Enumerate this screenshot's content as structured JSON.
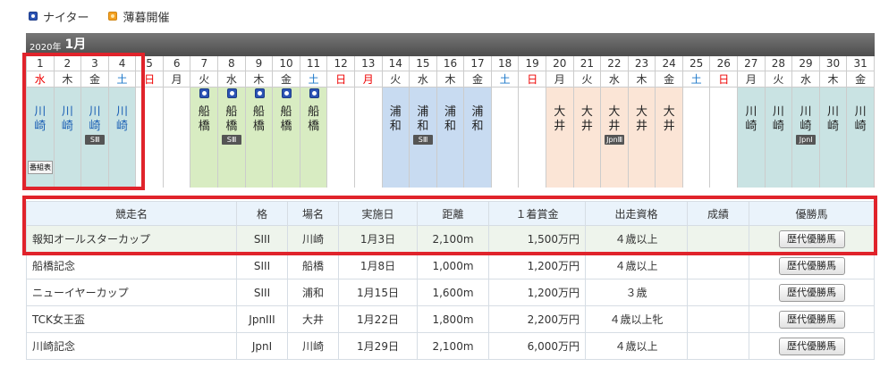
{
  "legend": {
    "night": "ナイター",
    "dusk": "薄暮開催",
    "night_icon": "night-race-icon",
    "dusk_icon": "dusk-race-icon"
  },
  "calendar": {
    "year_label": "2020年",
    "month_label": "1月",
    "days": [
      {
        "num": "1",
        "wk": "水",
        "type": "hol",
        "venue": "川\n崎",
        "vcls": "kawasaki",
        "vcolor": "blue",
        "night": false,
        "grade": "",
        "card": "番組表"
      },
      {
        "num": "2",
        "wk": "木",
        "type": "",
        "venue": "川\n崎",
        "vcls": "kawasaki",
        "vcolor": "blue",
        "night": false,
        "grade": "",
        "card": ""
      },
      {
        "num": "3",
        "wk": "金",
        "type": "",
        "venue": "川\n崎",
        "vcls": "kawasaki",
        "vcolor": "blue",
        "night": false,
        "grade": "SⅢ",
        "card": ""
      },
      {
        "num": "4",
        "wk": "土",
        "type": "sat",
        "venue": "川\n崎",
        "vcls": "kawasaki",
        "vcolor": "blue",
        "night": false,
        "grade": "",
        "card": ""
      },
      {
        "num": "5",
        "wk": "日",
        "type": "sun",
        "venue": "",
        "vcls": "",
        "vcolor": "",
        "night": false,
        "grade": "",
        "card": ""
      },
      {
        "num": "6",
        "wk": "月",
        "type": "",
        "venue": "",
        "vcls": "",
        "vcolor": "",
        "night": false,
        "grade": "",
        "card": ""
      },
      {
        "num": "7",
        "wk": "火",
        "type": "",
        "venue": "船\n橋",
        "vcls": "funabashi",
        "vcolor": "black",
        "night": true,
        "grade": "",
        "card": ""
      },
      {
        "num": "8",
        "wk": "水",
        "type": "",
        "venue": "船\n橋",
        "vcls": "funabashi",
        "vcolor": "black",
        "night": true,
        "grade": "SⅢ",
        "card": ""
      },
      {
        "num": "9",
        "wk": "木",
        "type": "",
        "venue": "船\n橋",
        "vcls": "funabashi",
        "vcolor": "black",
        "night": true,
        "grade": "",
        "card": ""
      },
      {
        "num": "10",
        "wk": "金",
        "type": "",
        "venue": "船\n橋",
        "vcls": "funabashi",
        "vcolor": "black",
        "night": true,
        "grade": "",
        "card": ""
      },
      {
        "num": "11",
        "wk": "土",
        "type": "sat",
        "venue": "船\n橋",
        "vcls": "funabashi",
        "vcolor": "black",
        "night": true,
        "grade": "",
        "card": ""
      },
      {
        "num": "12",
        "wk": "日",
        "type": "sun",
        "venue": "",
        "vcls": "",
        "vcolor": "",
        "night": false,
        "grade": "",
        "card": ""
      },
      {
        "num": "13",
        "wk": "月",
        "type": "hol",
        "venue": "",
        "vcls": "",
        "vcolor": "",
        "night": false,
        "grade": "",
        "card": ""
      },
      {
        "num": "14",
        "wk": "火",
        "type": "",
        "venue": "浦\n和",
        "vcls": "urawa",
        "vcolor": "black",
        "night": false,
        "grade": "",
        "card": ""
      },
      {
        "num": "15",
        "wk": "水",
        "type": "",
        "venue": "浦\n和",
        "vcls": "urawa",
        "vcolor": "black",
        "night": false,
        "grade": "SⅢ",
        "card": ""
      },
      {
        "num": "16",
        "wk": "木",
        "type": "",
        "venue": "浦\n和",
        "vcls": "urawa",
        "vcolor": "black",
        "night": false,
        "grade": "",
        "card": ""
      },
      {
        "num": "17",
        "wk": "金",
        "type": "",
        "venue": "浦\n和",
        "vcls": "urawa",
        "vcolor": "black",
        "night": false,
        "grade": "",
        "card": ""
      },
      {
        "num": "18",
        "wk": "土",
        "type": "sat",
        "venue": "",
        "vcls": "",
        "vcolor": "",
        "night": false,
        "grade": "",
        "card": ""
      },
      {
        "num": "19",
        "wk": "日",
        "type": "sun",
        "venue": "",
        "vcls": "",
        "vcolor": "",
        "night": false,
        "grade": "",
        "card": ""
      },
      {
        "num": "20",
        "wk": "月",
        "type": "",
        "venue": "大\n井",
        "vcls": "oi",
        "vcolor": "black",
        "night": false,
        "grade": "",
        "card": ""
      },
      {
        "num": "21",
        "wk": "火",
        "type": "",
        "venue": "大\n井",
        "vcls": "oi",
        "vcolor": "black",
        "night": false,
        "grade": "",
        "card": ""
      },
      {
        "num": "22",
        "wk": "水",
        "type": "",
        "venue": "大\n井",
        "vcls": "oi",
        "vcolor": "black",
        "night": false,
        "grade": "JpnⅢ",
        "card": ""
      },
      {
        "num": "23",
        "wk": "木",
        "type": "",
        "venue": "大\n井",
        "vcls": "oi",
        "vcolor": "black",
        "night": false,
        "grade": "",
        "card": ""
      },
      {
        "num": "24",
        "wk": "金",
        "type": "",
        "venue": "大\n井",
        "vcls": "oi",
        "vcolor": "black",
        "night": false,
        "grade": "",
        "card": ""
      },
      {
        "num": "25",
        "wk": "土",
        "type": "sat",
        "venue": "",
        "vcls": "",
        "vcolor": "",
        "night": false,
        "grade": "",
        "card": ""
      },
      {
        "num": "26",
        "wk": "日",
        "type": "sun",
        "venue": "",
        "vcls": "",
        "vcolor": "",
        "night": false,
        "grade": "",
        "card": ""
      },
      {
        "num": "27",
        "wk": "月",
        "type": "",
        "venue": "川\n崎",
        "vcls": "kawasaki",
        "vcolor": "black",
        "night": false,
        "grade": "",
        "card": ""
      },
      {
        "num": "28",
        "wk": "火",
        "type": "",
        "venue": "川\n崎",
        "vcls": "kawasaki",
        "vcolor": "black",
        "night": false,
        "grade": "",
        "card": ""
      },
      {
        "num": "29",
        "wk": "水",
        "type": "",
        "venue": "川\n崎",
        "vcls": "kawasaki",
        "vcolor": "black",
        "night": false,
        "grade": "JpnⅠ",
        "card": ""
      },
      {
        "num": "30",
        "wk": "木",
        "type": "",
        "venue": "川\n崎",
        "vcls": "kawasaki",
        "vcolor": "black",
        "night": false,
        "grade": "",
        "card": ""
      },
      {
        "num": "31",
        "wk": "金",
        "type": "",
        "venue": "川\n崎",
        "vcls": "kawasaki",
        "vcolor": "black",
        "night": false,
        "grade": "",
        "card": ""
      }
    ]
  },
  "table": {
    "headers": [
      "競走名",
      "格",
      "場名",
      "実施日",
      "距離",
      "１着賞金",
      "出走資格",
      "成績",
      "優勝馬"
    ],
    "rows": [
      {
        "name": "報知オールスターカップ",
        "grade": "SIII",
        "venue": "川崎",
        "date": "1月3日",
        "distance": "2,100m",
        "prize": "1,500万円",
        "qual": "４歳以上",
        "result": "",
        "button": "歴代優勝馬"
      },
      {
        "name": "船橋記念",
        "grade": "SIII",
        "venue": "船橋",
        "date": "1月8日",
        "distance": "1,000m",
        "prize": "1,200万円",
        "qual": "４歳以上",
        "result": "",
        "button": "歴代優勝馬"
      },
      {
        "name": "ニューイヤーカップ",
        "grade": "SIII",
        "venue": "浦和",
        "date": "1月15日",
        "distance": "1,600m",
        "prize": "1,200万円",
        "qual": "３歳",
        "result": "",
        "button": "歴代優勝馬"
      },
      {
        "name": "TCK女王盃",
        "grade": "JpnIII",
        "venue": "大井",
        "date": "1月22日",
        "distance": "1,800m",
        "prize": "2,200万円",
        "qual": "４歳以上牝",
        "result": "",
        "button": "歴代優勝馬"
      },
      {
        "name": "川崎記念",
        "grade": "JpnI",
        "venue": "川崎",
        "date": "1月29日",
        "distance": "2,100m",
        "prize": "6,000万円",
        "qual": "４歳以上",
        "result": "",
        "button": "歴代優勝馬"
      }
    ]
  },
  "colors": {
    "highlight": "#e0232b",
    "kawasaki": "#c9e3e3",
    "funabashi": "#d8ecc2",
    "urawa": "#c8dbf1",
    "oi": "#fbe5d6",
    "sunday_holiday": "#e00000",
    "saturday": "#1a77c9"
  }
}
